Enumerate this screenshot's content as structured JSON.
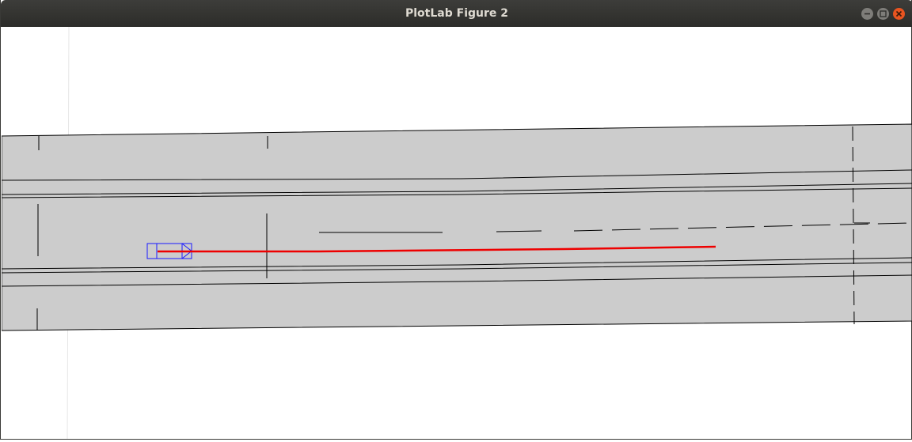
{
  "window": {
    "title": "PlotLab Figure 2",
    "controls": [
      "minimize-icon",
      "maximize-icon",
      "close-icon"
    ]
  },
  "colors": {
    "titlebar": "#2f2f2c",
    "title_text": "#dfdbd2",
    "road_fill": "#cccccc",
    "lane_line": "#000000",
    "vehicle_outline": "#0000cc",
    "trajectory": "#ee0000",
    "close_button": "#e95420",
    "window_button": "#7e7d79"
  },
  "figure": {
    "road": "grey multi-lane road segment",
    "vehicle": "ego-vehicle-box",
    "trajectory": "planned-trajectory-red"
  }
}
